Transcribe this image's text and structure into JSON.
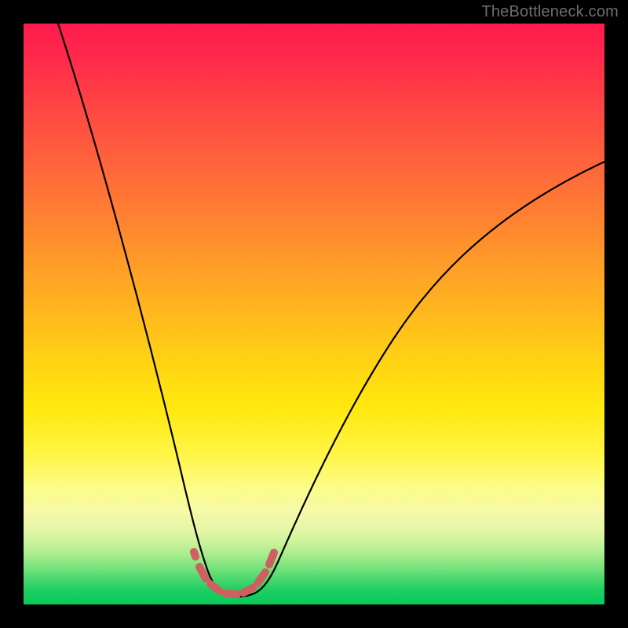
{
  "watermark": "TheBottleneck.com",
  "chart_data": {
    "type": "line",
    "title": "",
    "xlabel": "",
    "ylabel": "",
    "xlim": [
      0,
      100
    ],
    "ylim": [
      0,
      100
    ],
    "gradient_stops": [
      {
        "pct": 0,
        "color": "#ff1a4d"
      },
      {
        "pct": 14,
        "color": "#ff4444"
      },
      {
        "pct": 36,
        "color": "#ff8a2e"
      },
      {
        "pct": 58,
        "color": "#ffd214"
      },
      {
        "pct": 74,
        "color": "#fff544"
      },
      {
        "pct": 87,
        "color": "#e6f6a8"
      },
      {
        "pct": 95,
        "color": "#4cd86e"
      },
      {
        "pct": 100,
        "color": "#06c95a"
      }
    ],
    "series": [
      {
        "name": "left-branch",
        "x": [
          6,
          8,
          10,
          12,
          14,
          16,
          18,
          20,
          22,
          24,
          26,
          28,
          29,
          30,
          31,
          32
        ],
        "y": [
          100,
          92,
          84,
          76,
          68,
          60,
          52,
          44,
          36,
          28,
          20,
          12,
          8,
          5,
          3,
          2
        ]
      },
      {
        "name": "right-branch",
        "x": [
          41,
          43,
          46,
          50,
          55,
          60,
          65,
          70,
          75,
          80,
          85,
          90,
          95,
          100
        ],
        "y": [
          2,
          4,
          8,
          14,
          22,
          30,
          37,
          43,
          49,
          54,
          59,
          63,
          67,
          70
        ]
      },
      {
        "name": "valley-floor",
        "x": [
          32,
          34,
          36,
          38,
          40,
          41
        ],
        "y": [
          2,
          1.2,
          1,
          1,
          1.2,
          2
        ]
      }
    ],
    "overlay_segments": {
      "name": "pink-dashed",
      "color": "#d46a6a",
      "points_x": [
        29.5,
        31,
        32.5,
        34,
        35.5,
        37,
        38.5,
        40,
        41,
        42,
        43
      ],
      "points_y": [
        9,
        5.5,
        3.5,
        2.6,
        2.3,
        2.3,
        2.6,
        3.4,
        4.2,
        5.2,
        7
      ]
    }
  }
}
